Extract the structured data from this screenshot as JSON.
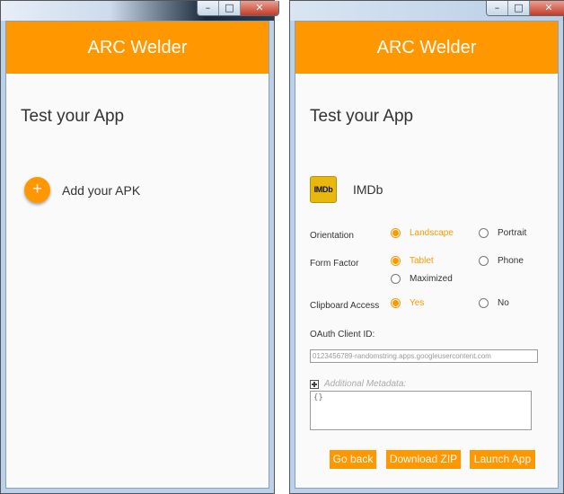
{
  "left_window": {
    "app_title": "ARC Welder",
    "heading": "Test your App",
    "add_apk_label": "Add your APK",
    "add_button_symbol": "+"
  },
  "right_window": {
    "app_title": "ARC Welder",
    "heading": "Test your App",
    "app": {
      "icon_text": "IMDb",
      "name": "IMDb"
    },
    "orientation": {
      "label": "Orientation",
      "options": [
        "Landscape",
        "Portrait"
      ],
      "selected": "Landscape"
    },
    "form_factor": {
      "label": "Form Factor",
      "options": [
        "Tablet",
        "Phone",
        "Maximized"
      ],
      "selected": "Tablet"
    },
    "clipboard": {
      "label": "Clipboard Access",
      "options": [
        "Yes",
        "No"
      ],
      "selected": "Yes"
    },
    "oauth": {
      "label": "OAuth Client ID:",
      "placeholder": "0123456789-randomstring.apps.googleusercontent.com"
    },
    "metadata": {
      "label": "Additional Metadata:",
      "value": "{}"
    },
    "buttons": {
      "go_back": "Go back",
      "download_zip": "Download ZIP",
      "launch_app": "Launch App"
    }
  },
  "window_controls": {
    "minimize": "–",
    "maximize": "□",
    "close": "✕"
  },
  "colors": {
    "accent": "#ff9800",
    "background": "#fafafa"
  }
}
